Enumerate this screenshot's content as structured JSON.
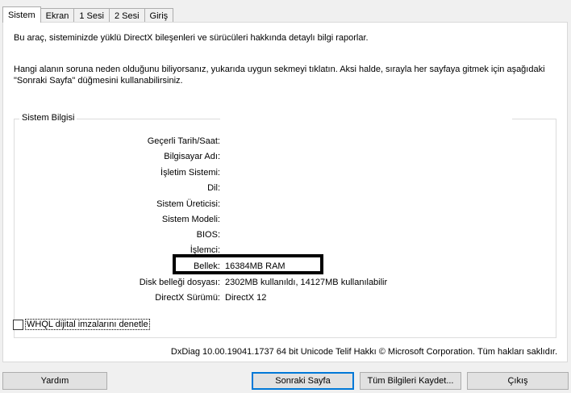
{
  "tabs": [
    "Sistem",
    "Ekran",
    "1 Sesi",
    "2 Sesi",
    "Giriş"
  ],
  "intro": {
    "line1": "Bu araç, sisteminizde yüklü DirectX bileşenleri ve sürücüleri hakkında detaylı bilgi raporlar.",
    "line2a": "Hangi alanın soruna neden olduğunu biliyorsanız, yukarıda uygun sekmeyi tıklatın. Aksi halde, sırayla her sayfaya gitmek için aşağıdaki",
    "line2b": "\"Sonraki Sayfa\" düğmesini kullanabilirsiniz."
  },
  "system_info": {
    "title": "Sistem Bilgisi",
    "rows": [
      {
        "label": "Geçerli Tarih/Saat:",
        "value": ""
      },
      {
        "label": "Bilgisayar Adı:",
        "value": ""
      },
      {
        "label": "İşletim Sistemi:",
        "value": ""
      },
      {
        "label": "Dil:",
        "value": ""
      },
      {
        "label": "Sistem Üreticisi:",
        "value": ""
      },
      {
        "label": "Sistem Modeli:",
        "value": ""
      },
      {
        "label": "BIOS:",
        "value": ""
      },
      {
        "label": "İşlemci:",
        "value": ""
      },
      {
        "label": "Bellek:",
        "value": "16384MB RAM"
      },
      {
        "label": "Disk belleği dosyası:",
        "value": "2302MB kullanıldı, 14127MB kullanılabilir"
      },
      {
        "label": "DirectX Sürümü:",
        "value": "DirectX 12"
      }
    ]
  },
  "whql_label": "WHQL dijital imzalarını denetle",
  "whql_checked": false,
  "footer_text": "DxDiag 10.00.19041.1737 64 bit Unicode  Telif Hakkı © Microsoft Corporation. Tüm hakları saklıdır.",
  "buttons": {
    "help": "Yardım",
    "next": "Sonraki Sayfa",
    "save_all": "Tüm Bilgileri Kaydet...",
    "exit": "Çıkış"
  }
}
